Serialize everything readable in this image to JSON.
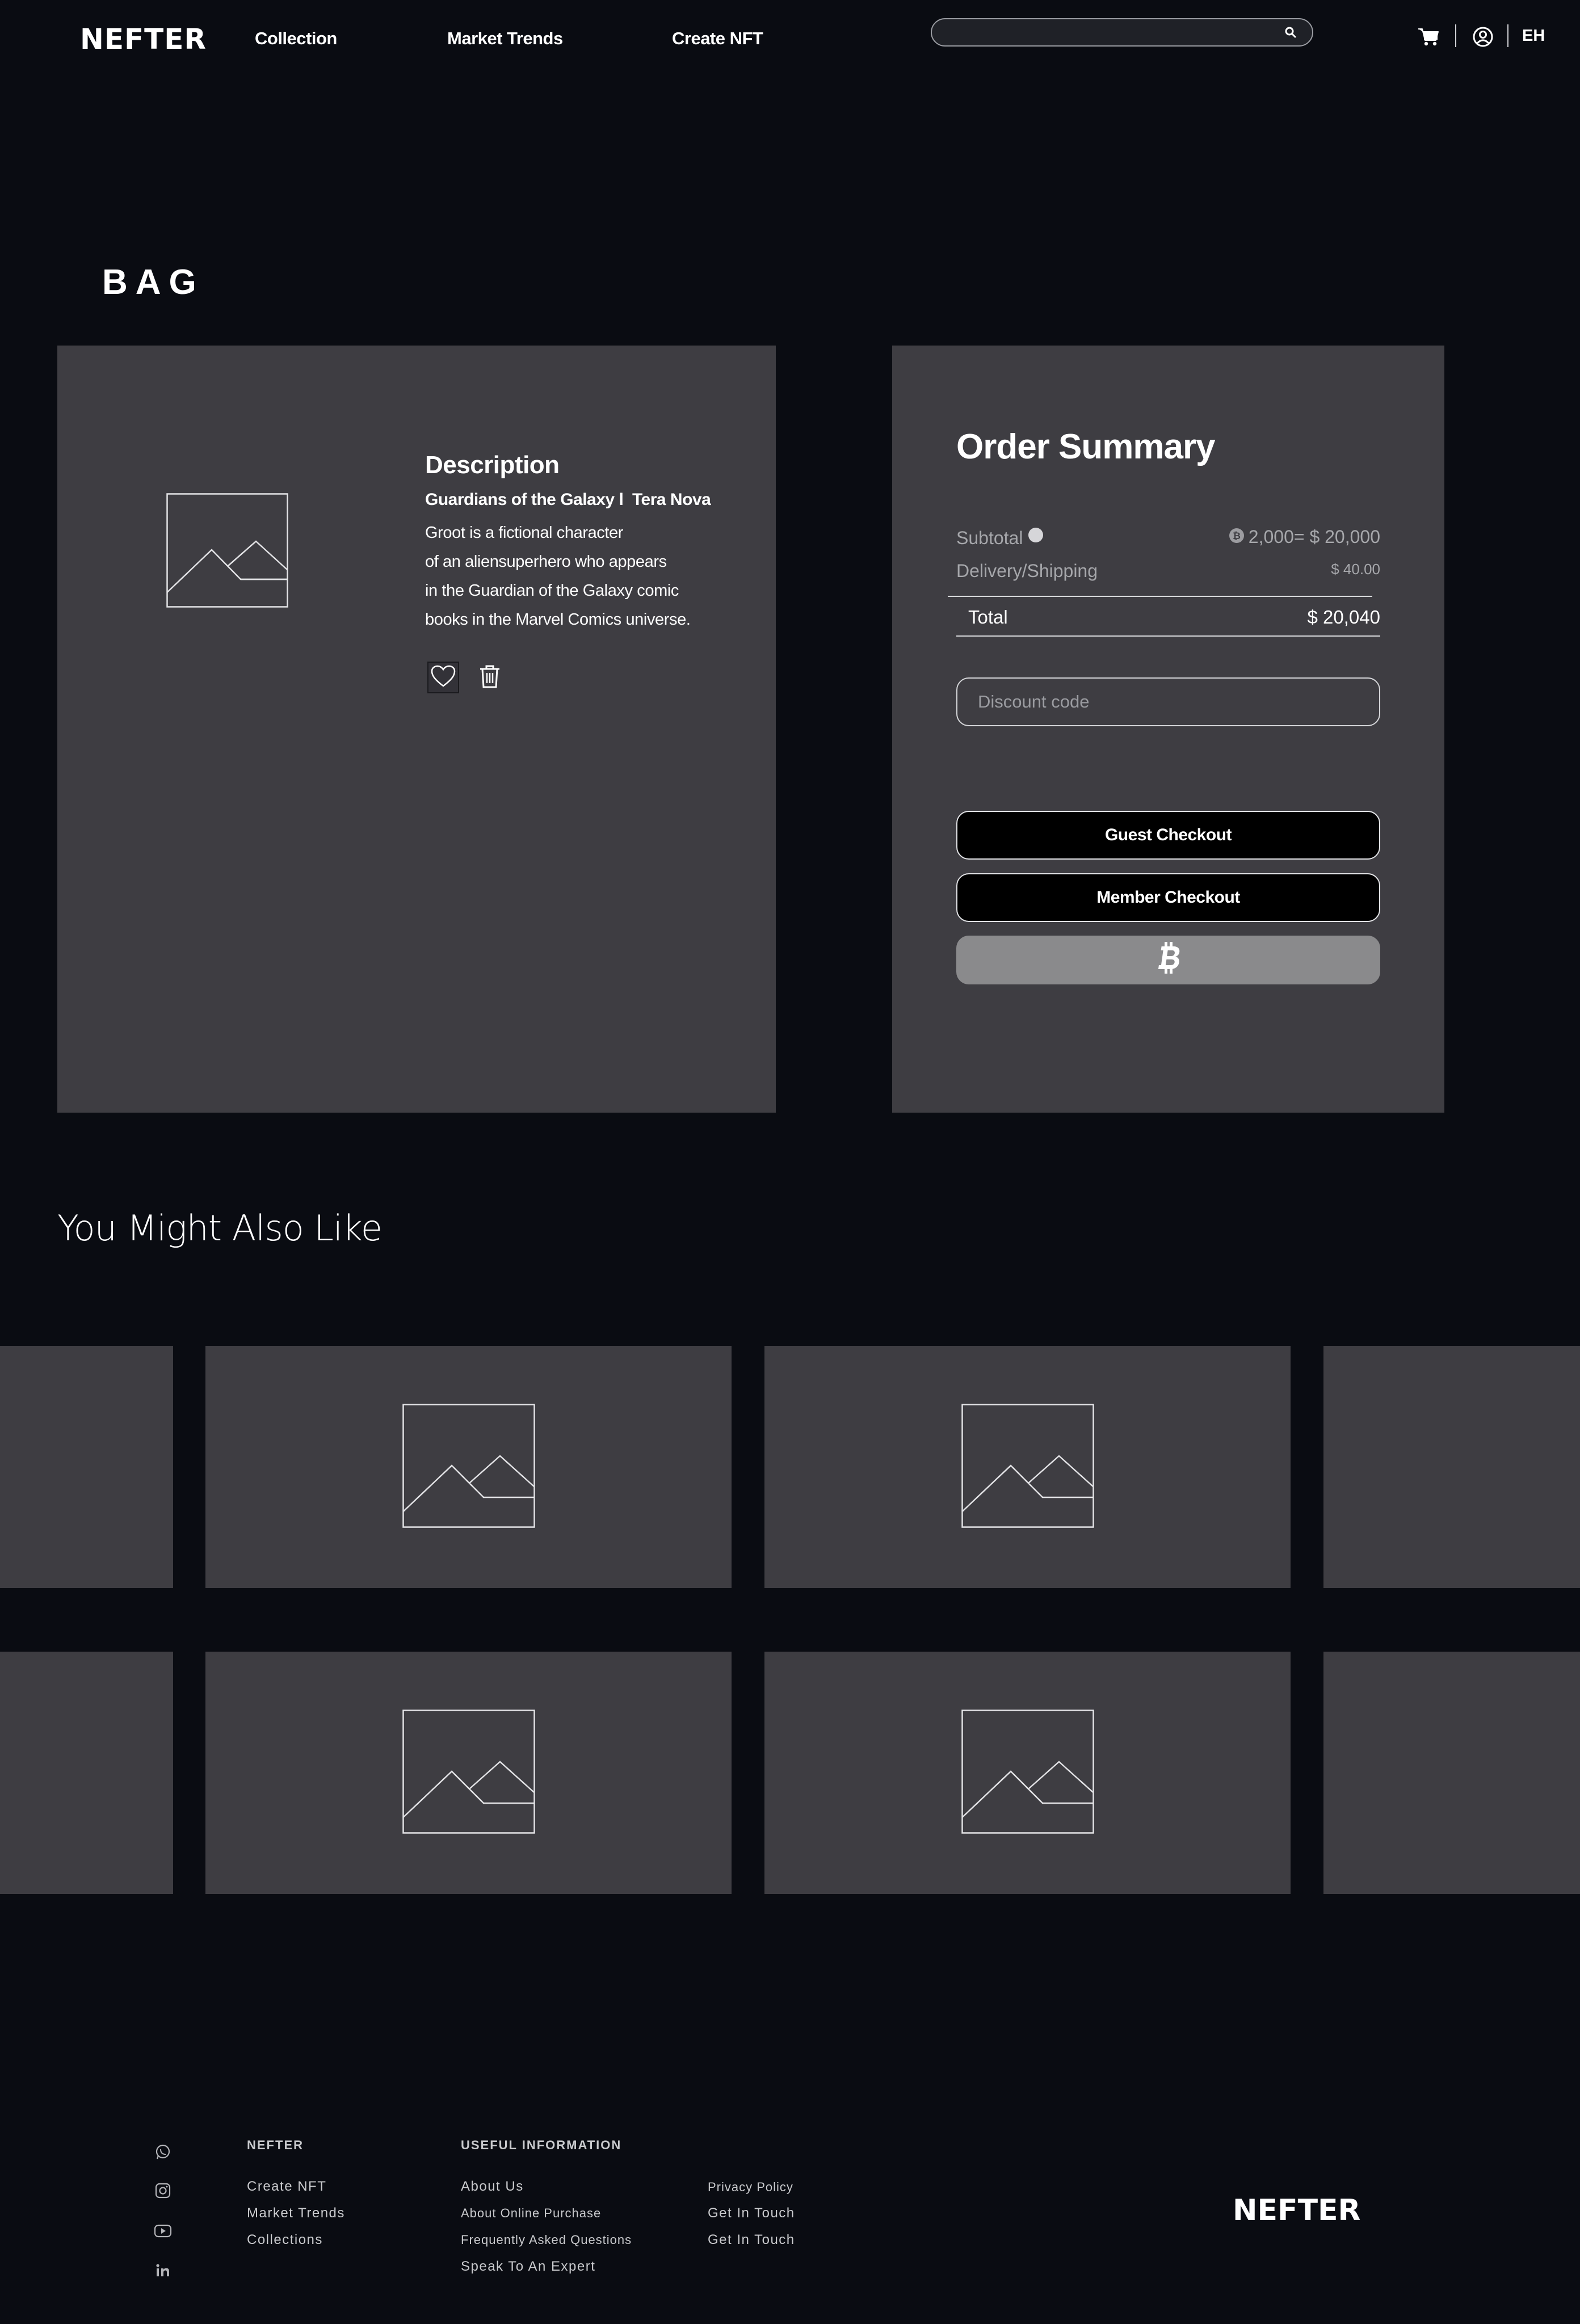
{
  "header": {
    "logo": "NEFTER",
    "nav": [
      "Collection",
      "Market Trends",
      "Create NFT"
    ],
    "search_placeholder": "",
    "language": "EH"
  },
  "bag": {
    "title": "BAG",
    "item": {
      "description_title": "Description",
      "subtitle": "Guardians of the Galaxy l  Tera Nova",
      "body_lines": [
        "Groot is a fictional character",
        "of an aliensuperhero who appears",
        "in the Guardian of the Galaxy comic",
        "books in the Marvel Comics universe."
      ]
    }
  },
  "order_summary": {
    "title": "Order Summary",
    "subtotal_label": "Subtotal",
    "subtotal_value": "2,000= $ 20,000",
    "delivery_label": "Delivery/Shipping",
    "delivery_value": "$ 40.00",
    "total_label": "Total",
    "total_value": "$ 20,040",
    "discount_placeholder": "Discount code",
    "guest_checkout": "Guest Checkout",
    "member_checkout": "Member Checkout"
  },
  "recommendations": {
    "title": "You Might Also Like"
  },
  "footer": {
    "col1": {
      "heading": "NEFTER",
      "links": [
        "Create NFT",
        "Market Trends",
        "Collections"
      ]
    },
    "col2": {
      "heading": "USEFUL INFORMATION",
      "links": [
        "About Us",
        "About Online Purchase",
        "Frequently Asked Questions",
        "Speak To An Expert"
      ]
    },
    "col3": {
      "links": [
        "Privacy Policy",
        "Get In Touch",
        "Get In Touch"
      ]
    },
    "social_icons": [
      "whatsapp-icon",
      "instagram-icon",
      "youtube-icon",
      "linkedin-icon"
    ],
    "logo": "NEFTER"
  },
  "colors": {
    "background": "#0a0c12",
    "panel": "#3e3d42",
    "crypto_button": "#8a8a8c"
  }
}
